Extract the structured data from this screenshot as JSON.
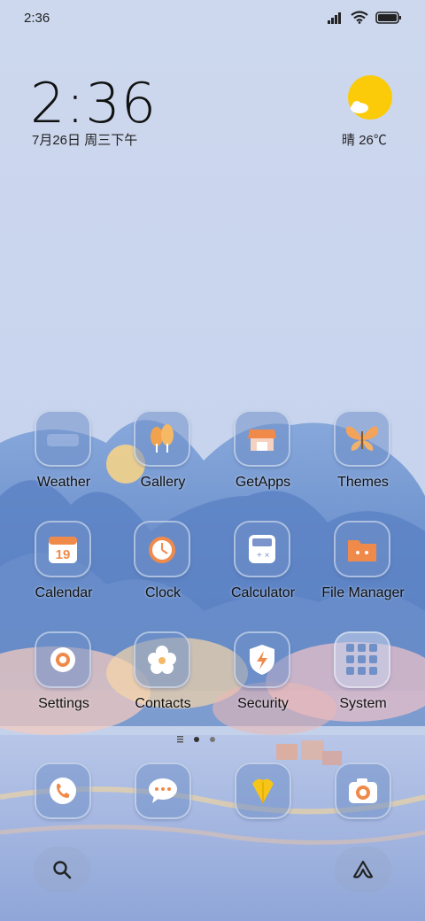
{
  "status_bar": {
    "time": "2:36"
  },
  "lock_clock": {
    "time": "2:36",
    "date": "7月26日 周三下午"
  },
  "weather": {
    "condition": "晴",
    "temperature": "26℃"
  },
  "apps": [
    {
      "label": "Weather",
      "icon": "weather-app-icon"
    },
    {
      "label": "Gallery",
      "icon": "gallery-app-icon"
    },
    {
      "label": "GetApps",
      "icon": "getapps-app-icon"
    },
    {
      "label": "Themes",
      "icon": "themes-app-icon"
    },
    {
      "label": "Calendar",
      "icon": "calendar-app-icon",
      "badge": "19"
    },
    {
      "label": "Clock",
      "icon": "clock-app-icon"
    },
    {
      "label": "Calculator",
      "icon": "calculator-app-icon"
    },
    {
      "label": "File Manager",
      "icon": "file-manager-app-icon"
    },
    {
      "label": "Settings",
      "icon": "settings-app-icon"
    },
    {
      "label": "Contacts",
      "icon": "contacts-app-icon"
    },
    {
      "label": "Security",
      "icon": "security-app-icon"
    },
    {
      "label": "System",
      "icon": "system-folder-icon"
    }
  ],
  "dock": [
    {
      "icon": "phone-app-icon"
    },
    {
      "icon": "messages-app-icon"
    },
    {
      "icon": "browser-app-icon"
    },
    {
      "icon": "camera-app-icon"
    }
  ],
  "colors": {
    "accent_orange": "#f08a4b",
    "sun_yellow": "#fbcb0a",
    "tile_blue": "#7090c8"
  }
}
